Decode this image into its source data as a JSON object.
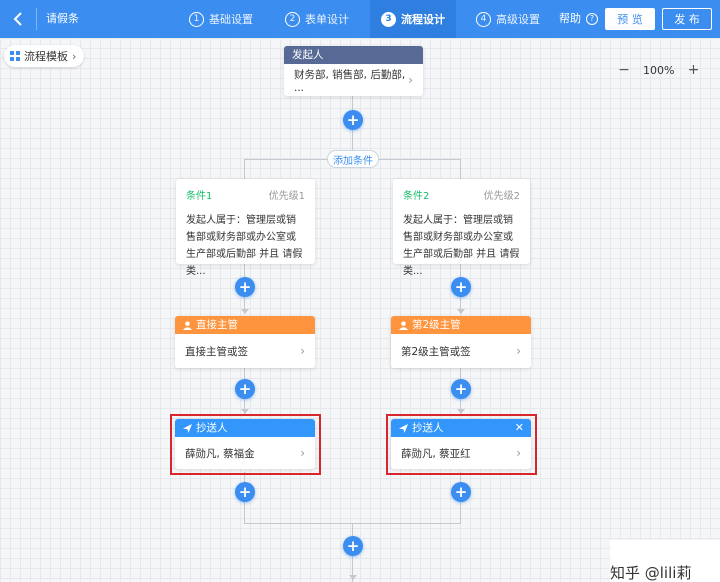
{
  "header": {
    "title": "请假条",
    "steps": [
      {
        "num": "1",
        "label": "基础设置"
      },
      {
        "num": "2",
        "label": "表单设计"
      },
      {
        "num": "3",
        "label": "流程设计"
      },
      {
        "num": "4",
        "label": "高级设置"
      }
    ],
    "active_step": 3,
    "help_label": "帮助",
    "preview_label": "预 览",
    "publish_label": "发 布"
  },
  "canvas": {
    "template_label": "流程模板",
    "zoom_level": "100%",
    "add_condition_label": "添加条件"
  },
  "initiator": {
    "title": "发起人",
    "content": "财务部, 销售部, 后勤部, ..."
  },
  "branches": [
    {
      "condition": {
        "name": "条件1",
        "priority": "优先级1",
        "text": "发起人属于：管理层或销售部或财务部或办公室或生产部或后勤部 并且 请假类..."
      },
      "approver": {
        "title": "直接主管",
        "content": "直接主管或签"
      },
      "cc": {
        "title": "抄送人",
        "content": "薛勋凡, 蔡福金"
      }
    },
    {
      "condition": {
        "name": "条件2",
        "priority": "优先级2",
        "text": "发起人属于：管理层或销售部或财务部或办公室或生产部或后勤部 并且 请假类..."
      },
      "approver": {
        "title": "第2级主管",
        "content": "第2级主管或签"
      },
      "cc": {
        "title": "抄送人",
        "content": "薛勋凡, 蔡亚红"
      }
    }
  ],
  "watermark": "知乎 @lili莉",
  "colors": {
    "primary": "#3b8df0",
    "initiator_header": "#576a95",
    "approver_header": "#ff943e",
    "cc_header": "#3296fa",
    "condition_name": "#19be6b",
    "highlight": "#d9262c"
  }
}
